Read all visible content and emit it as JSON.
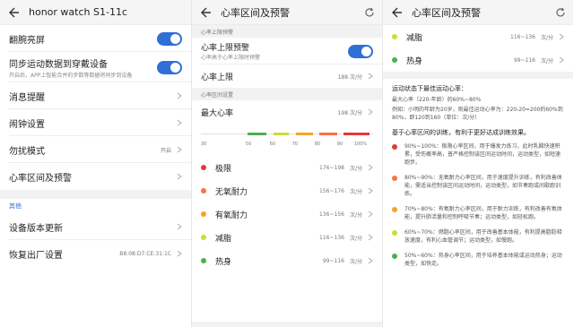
{
  "screen1": {
    "title": "honor watch S1-11c",
    "rows": [
      {
        "label": "翻腕亮屏",
        "type": "toggle"
      },
      {
        "label": "同步运动数据到穿戴设备",
        "sub": "开启后，APP上智能合并的步数等数据将同步到设备",
        "type": "toggle"
      },
      {
        "label": "消息提醒",
        "type": "chevron"
      },
      {
        "label": "闹钟设置",
        "type": "chevron"
      },
      {
        "label": "勿扰模式",
        "value": "开启",
        "type": "chevron"
      },
      {
        "label": "心率区间及预警",
        "type": "chevron"
      }
    ],
    "section_label": "其他",
    "rows2": [
      {
        "label": "设备版本更新",
        "type": "chevron"
      },
      {
        "label": "恢复出厂设置",
        "value": "B8:08:D7:CE:31:1C",
        "type": "chevron"
      }
    ]
  },
  "screen2": {
    "title": "心率区间及预警",
    "sec1": "心率上限预警",
    "alert_label": "心率上限预警",
    "alert_sub": "心率高于心率上限时预警",
    "upper_label": "心率上限",
    "upper_value": "188 次/分",
    "sec2": "心率区间设置",
    "max_label": "最大心率",
    "max_value": "198 次/分",
    "scale_ticks": [
      "30",
      "50",
      "60",
      "70",
      "80",
      "90",
      "100%"
    ],
    "zones": [
      {
        "name": "极限",
        "range": "176~198",
        "unit": "次/分",
        "color": "#e53935"
      },
      {
        "name": "无氧耐力",
        "range": "156~176",
        "unit": "次/分",
        "color": "#ff7043"
      },
      {
        "name": "有氧耐力",
        "range": "136~156",
        "unit": "次/分",
        "color": "#f5a623"
      },
      {
        "name": "减脂",
        "range": "116~136",
        "unit": "次/分",
        "color": "#cddc39"
      },
      {
        "name": "热身",
        "range": "99~116",
        "unit": "次/分",
        "color": "#4caf50"
      }
    ]
  },
  "screen3": {
    "title": "心率区间及预警",
    "zones": [
      {
        "name": "减脂",
        "range": "116~136",
        "unit": "次/分",
        "color": "#cddc39"
      },
      {
        "name": "热身",
        "range": "99~116",
        "unit": "次/分",
        "color": "#4caf50"
      }
    ],
    "info_title": "运动状态下最佳运动心率：",
    "info_para1": "最大心率（220-年龄）的60%~80%",
    "info_para2": "例如：小明的年龄为20岁，则最佳运动心率为：220-20=200的60%到80%，即120到160（单位：次/分）",
    "info_title2": "基于心率区间的训练，有利于更好达成训练效果。",
    "bullets": [
      {
        "color": "#e53935",
        "text": "90%~100%：极限心率区间，用于爆发力练习，此时乳酸快速积累，受伤概率高，普严格控制该区间运动时间，运动类型，如短速跑步。"
      },
      {
        "color": "#ff7043",
        "text": "80%~90%：无氧耐力心率区间，用于速度提升训练，有利改善体能，需适当控制该区间运动时间，运动类型，如节奏跑或间歇跑训练。"
      },
      {
        "color": "#f5a623",
        "text": "70%~80%：有氧耐力心率区间，用于耐力训练，有利改善有氧体能，提升肺活量和控制呼吸节奏；运动类型，如轻松跑。"
      },
      {
        "color": "#cddc39",
        "text": "60%~70%：燃脂心率区间，用于改善基本体能，有利提高脂肪释放速度，有利心血管调节；运动类型，如慢跑。"
      },
      {
        "color": "#4caf50",
        "text": "50%~60%：热身心率区间，用于培养基本体能或运动热身；运动类型，如快走。"
      }
    ]
  }
}
